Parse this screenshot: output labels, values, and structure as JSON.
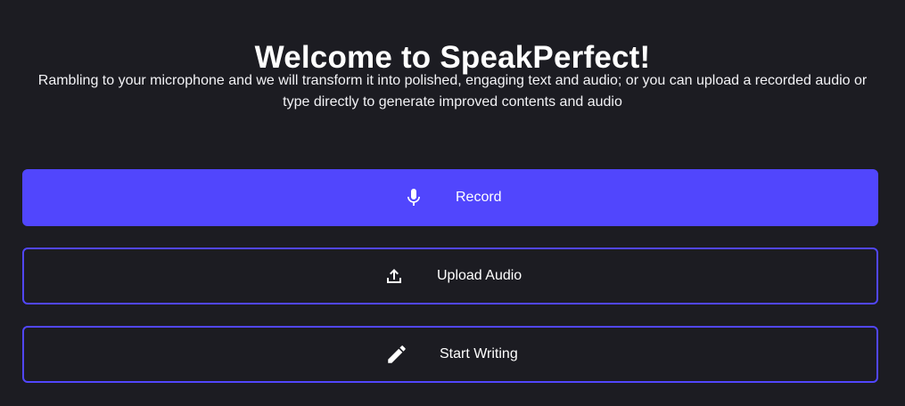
{
  "header": {
    "title": "Welcome to SpeakPerfect!",
    "subtitle": "Rambling to your microphone and we will transform it into polished, engaging text and audio; or you can upload a recorded audio or type directly to generate improved contents and audio"
  },
  "actions": {
    "record": {
      "label": "Record",
      "icon": "microphone-icon"
    },
    "upload": {
      "label": "Upload Audio",
      "icon": "upload-icon"
    },
    "write": {
      "label": "Start Writing",
      "icon": "pencil-icon"
    }
  },
  "colors": {
    "background": "#1c1c22",
    "accent": "#5146fd",
    "text": "#ffffff"
  }
}
